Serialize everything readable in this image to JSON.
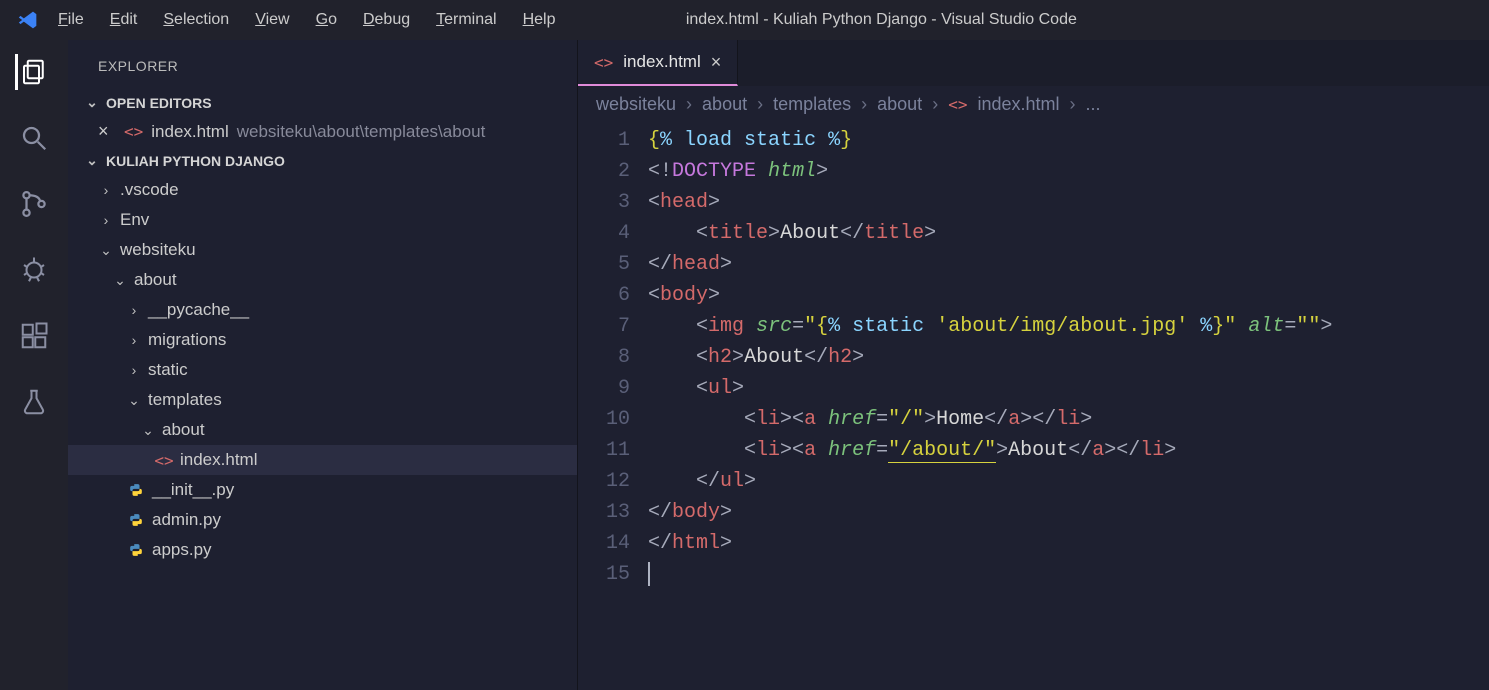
{
  "window_title": "index.html - Kuliah Python Django - Visual Studio Code",
  "menu": [
    "File",
    "Edit",
    "Selection",
    "View",
    "Go",
    "Debug",
    "Terminal",
    "Help"
  ],
  "explorer": {
    "panel_title": "EXPLORER",
    "open_editors_label": "OPEN EDITORS",
    "open_editor": {
      "filename": "index.html",
      "path": "websiteku\\about\\templates\\about"
    },
    "workspace_label": "KULIAH PYTHON DJANGO",
    "tree": {
      "vscode": ".vscode",
      "env": "Env",
      "websiteku": "websiteku",
      "about": "about",
      "pycache": "__pycache__",
      "migrations": "migrations",
      "static": "static",
      "templates": "templates",
      "about2": "about",
      "indexhtml": "index.html",
      "initpy": "__init__.py",
      "adminpy": "admin.py",
      "appspy": "apps.py"
    }
  },
  "tab": {
    "label": "index.html"
  },
  "breadcrumbs": {
    "p1": "websiteku",
    "p2": "about",
    "p3": "templates",
    "p4": "about",
    "p5": "index.html",
    "p6": "..."
  },
  "code": {
    "lines": [
      "1",
      "2",
      "3",
      "4",
      "5",
      "6",
      "7",
      "8",
      "9",
      "10",
      "11",
      "12",
      "13",
      "14",
      "15"
    ],
    "l1_load": "load static",
    "l2_doctype": "DOCTYPE",
    "l2_html": "html",
    "l3_head": "head",
    "l4_title": "title",
    "l4_text": "About",
    "l5_head": "head",
    "l6_body": "body",
    "l7_img": "img",
    "l7_src": "src",
    "l7_static": "static",
    "l7_path": "'about/img/about.jpg'",
    "l7_alt": "alt",
    "l8_h2": "h2",
    "l8_text": "About",
    "l9_ul": "ul",
    "l10_li": "li",
    "l10_a": "a",
    "l10_href": "href",
    "l10_url": "\"/\"",
    "l10_text": "Home",
    "l11_li": "li",
    "l11_a": "a",
    "l11_href": "href",
    "l11_url": "\"/about/\"",
    "l11_text": "About",
    "l12_ul": "ul",
    "l13_body": "body",
    "l14_html": "html"
  }
}
